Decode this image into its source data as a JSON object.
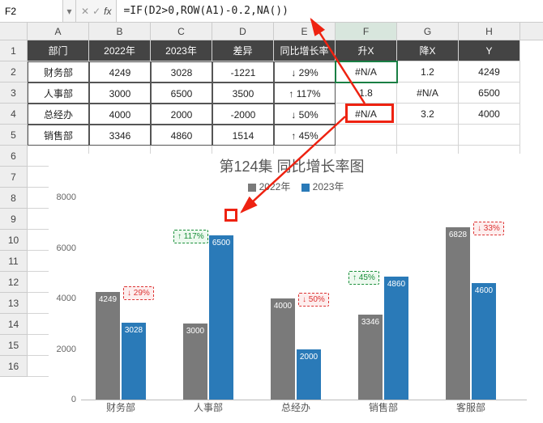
{
  "formula_bar": {
    "cell_ref": "F2",
    "formula": "=IF(D2>0,ROW(A1)-0.2,NA())"
  },
  "columns": [
    "A",
    "B",
    "C",
    "D",
    "E",
    "F",
    "G",
    "H"
  ],
  "row_numbers": [
    1,
    2,
    3,
    4,
    5,
    6,
    7,
    8,
    9,
    10,
    11,
    12,
    13,
    14,
    15,
    16
  ],
  "table": {
    "headers": [
      "部门",
      "2022年",
      "2023年",
      "差异",
      "同比增长率",
      "升X",
      "降X",
      "Y"
    ],
    "rows": [
      {
        "a": "财务部",
        "b": "4249",
        "c": "3028",
        "d": "-1221",
        "e": "↓ 29%",
        "f": "#N/A",
        "g": "1.2",
        "h": "4249"
      },
      {
        "a": "人事部",
        "b": "3000",
        "c": "6500",
        "d": "3500",
        "e": "↑ 117%",
        "f": "1.8",
        "g": "#N/A",
        "h": "6500"
      },
      {
        "a": "总经办",
        "b": "4000",
        "c": "2000",
        "d": "-2000",
        "e": "↓ 50%",
        "f": "#N/A",
        "g": "3.2",
        "h": "4000"
      },
      {
        "a": "销售部",
        "b": "3346",
        "c": "4860",
        "d": "1514",
        "e": "↑ 45%",
        "f": "",
        "g": "",
        "h": ""
      }
    ]
  },
  "chart_data": {
    "type": "bar",
    "title": "第124集 同比增长率图",
    "legend": [
      "2022年",
      "2023年"
    ],
    "ylim": [
      0,
      8000
    ],
    "yticks": [
      0,
      2000,
      4000,
      6000,
      8000
    ],
    "categories": [
      "财务部",
      "人事部",
      "总经办",
      "销售部",
      "客服部"
    ],
    "series": [
      {
        "name": "2022年",
        "values": [
          4249,
          3000,
          4000,
          3346,
          6828
        ],
        "color": "#7a7a7a"
      },
      {
        "name": "2023年",
        "values": [
          3028,
          6500,
          2000,
          4860,
          4600
        ],
        "color": "#2a7ab8"
      }
    ],
    "pct_labels": [
      {
        "cat": 0,
        "text": "↓ 29%",
        "dir": "dn"
      },
      {
        "cat": 1,
        "text": "↑ 117%",
        "dir": "up"
      },
      {
        "cat": 2,
        "text": "↓ 50%",
        "dir": "dn"
      },
      {
        "cat": 3,
        "text": "↑ 45%",
        "dir": "up"
      },
      {
        "cat": 4,
        "text": "↓ 33%",
        "dir": "dn"
      }
    ]
  }
}
